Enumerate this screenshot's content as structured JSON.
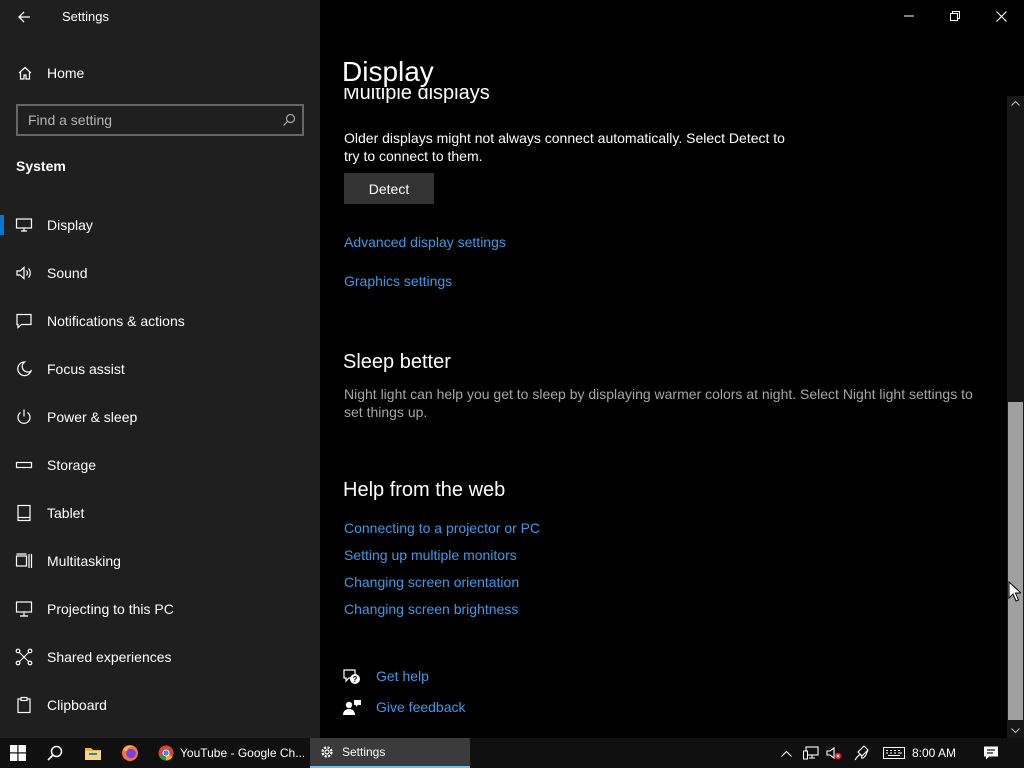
{
  "window": {
    "title": "Settings"
  },
  "sidebar": {
    "home_label": "Home",
    "search_placeholder": "Find a setting",
    "section_header": "System",
    "items": [
      {
        "label": "Display",
        "icon": "display-icon",
        "selected": true
      },
      {
        "label": "Sound",
        "icon": "sound-icon"
      },
      {
        "label": "Notifications & actions",
        "icon": "notifications-icon"
      },
      {
        "label": "Focus assist",
        "icon": "moon-icon"
      },
      {
        "label": "Power & sleep",
        "icon": "power-icon"
      },
      {
        "label": "Storage",
        "icon": "storage-icon"
      },
      {
        "label": "Tablet",
        "icon": "tablet-icon"
      },
      {
        "label": "Multitasking",
        "icon": "multitasking-icon"
      },
      {
        "label": "Projecting to this PC",
        "icon": "projecting-icon"
      },
      {
        "label": "Shared experiences",
        "icon": "shared-experiences-icon"
      },
      {
        "label": "Clipboard",
        "icon": "clipboard-icon"
      }
    ]
  },
  "main": {
    "page_title": "Display",
    "multiple_displays": {
      "heading": "Multiple displays",
      "description": "Older displays might not always connect automatically. Select Detect to try to connect to them.",
      "detect_button": "Detect"
    },
    "links": {
      "advanced": "Advanced display settings",
      "graphics": "Graphics settings"
    },
    "sleep_better": {
      "heading": "Sleep better",
      "description": "Night light can help you get to sleep by displaying warmer colors at night. Select Night light settings to set things up."
    },
    "help_web": {
      "heading": "Help from the web",
      "links": [
        "Connecting to a projector or PC",
        "Setting up multiple monitors",
        "Changing screen orientation",
        "Changing screen brightness"
      ]
    },
    "get_help": "Get help",
    "give_feedback": "Give feedback"
  },
  "taskbar": {
    "chrome_label": "YouTube - Google Ch...",
    "settings_label": "Settings",
    "clock": "8:00 AM"
  },
  "colors": {
    "accent": "#0078d7",
    "link": "#3b9ae8",
    "sidebar_bg": "#1f1f1f",
    "main_bg": "#000000"
  }
}
